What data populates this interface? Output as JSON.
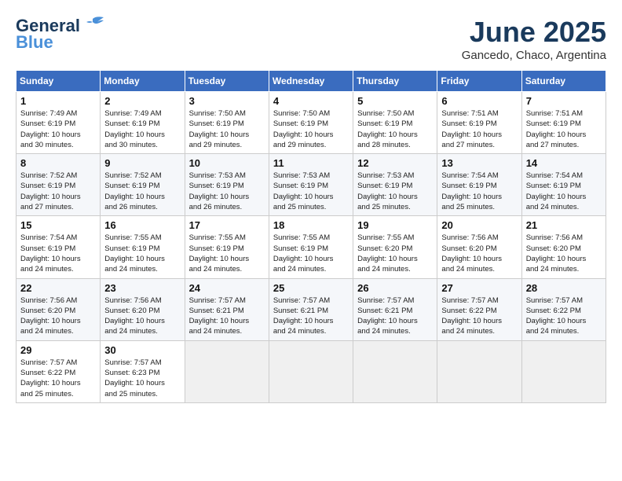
{
  "logo": {
    "line1": "General",
    "line2": "Blue"
  },
  "title": {
    "month": "June 2025",
    "location": "Gancedo, Chaco, Argentina"
  },
  "days_of_week": [
    "Sunday",
    "Monday",
    "Tuesday",
    "Wednesday",
    "Thursday",
    "Friday",
    "Saturday"
  ],
  "weeks": [
    [
      {
        "day": "1",
        "info": "Sunrise: 7:49 AM\nSunset: 6:19 PM\nDaylight: 10 hours\nand 30 minutes."
      },
      {
        "day": "2",
        "info": "Sunrise: 7:49 AM\nSunset: 6:19 PM\nDaylight: 10 hours\nand 30 minutes."
      },
      {
        "day": "3",
        "info": "Sunrise: 7:50 AM\nSunset: 6:19 PM\nDaylight: 10 hours\nand 29 minutes."
      },
      {
        "day": "4",
        "info": "Sunrise: 7:50 AM\nSunset: 6:19 PM\nDaylight: 10 hours\nand 29 minutes."
      },
      {
        "day": "5",
        "info": "Sunrise: 7:50 AM\nSunset: 6:19 PM\nDaylight: 10 hours\nand 28 minutes."
      },
      {
        "day": "6",
        "info": "Sunrise: 7:51 AM\nSunset: 6:19 PM\nDaylight: 10 hours\nand 27 minutes."
      },
      {
        "day": "7",
        "info": "Sunrise: 7:51 AM\nSunset: 6:19 PM\nDaylight: 10 hours\nand 27 minutes."
      }
    ],
    [
      {
        "day": "8",
        "info": "Sunrise: 7:52 AM\nSunset: 6:19 PM\nDaylight: 10 hours\nand 27 minutes."
      },
      {
        "day": "9",
        "info": "Sunrise: 7:52 AM\nSunset: 6:19 PM\nDaylight: 10 hours\nand 26 minutes."
      },
      {
        "day": "10",
        "info": "Sunrise: 7:53 AM\nSunset: 6:19 PM\nDaylight: 10 hours\nand 26 minutes."
      },
      {
        "day": "11",
        "info": "Sunrise: 7:53 AM\nSunset: 6:19 PM\nDaylight: 10 hours\nand 25 minutes."
      },
      {
        "day": "12",
        "info": "Sunrise: 7:53 AM\nSunset: 6:19 PM\nDaylight: 10 hours\nand 25 minutes."
      },
      {
        "day": "13",
        "info": "Sunrise: 7:54 AM\nSunset: 6:19 PM\nDaylight: 10 hours\nand 25 minutes."
      },
      {
        "day": "14",
        "info": "Sunrise: 7:54 AM\nSunset: 6:19 PM\nDaylight: 10 hours\nand 24 minutes."
      }
    ],
    [
      {
        "day": "15",
        "info": "Sunrise: 7:54 AM\nSunset: 6:19 PM\nDaylight: 10 hours\nand 24 minutes."
      },
      {
        "day": "16",
        "info": "Sunrise: 7:55 AM\nSunset: 6:19 PM\nDaylight: 10 hours\nand 24 minutes."
      },
      {
        "day": "17",
        "info": "Sunrise: 7:55 AM\nSunset: 6:19 PM\nDaylight: 10 hours\nand 24 minutes."
      },
      {
        "day": "18",
        "info": "Sunrise: 7:55 AM\nSunset: 6:19 PM\nDaylight: 10 hours\nand 24 minutes."
      },
      {
        "day": "19",
        "info": "Sunrise: 7:55 AM\nSunset: 6:20 PM\nDaylight: 10 hours\nand 24 minutes."
      },
      {
        "day": "20",
        "info": "Sunrise: 7:56 AM\nSunset: 6:20 PM\nDaylight: 10 hours\nand 24 minutes."
      },
      {
        "day": "21",
        "info": "Sunrise: 7:56 AM\nSunset: 6:20 PM\nDaylight: 10 hours\nand 24 minutes."
      }
    ],
    [
      {
        "day": "22",
        "info": "Sunrise: 7:56 AM\nSunset: 6:20 PM\nDaylight: 10 hours\nand 24 minutes."
      },
      {
        "day": "23",
        "info": "Sunrise: 7:56 AM\nSunset: 6:20 PM\nDaylight: 10 hours\nand 24 minutes."
      },
      {
        "day": "24",
        "info": "Sunrise: 7:57 AM\nSunset: 6:21 PM\nDaylight: 10 hours\nand 24 minutes."
      },
      {
        "day": "25",
        "info": "Sunrise: 7:57 AM\nSunset: 6:21 PM\nDaylight: 10 hours\nand 24 minutes."
      },
      {
        "day": "26",
        "info": "Sunrise: 7:57 AM\nSunset: 6:21 PM\nDaylight: 10 hours\nand 24 minutes."
      },
      {
        "day": "27",
        "info": "Sunrise: 7:57 AM\nSunset: 6:22 PM\nDaylight: 10 hours\nand 24 minutes."
      },
      {
        "day": "28",
        "info": "Sunrise: 7:57 AM\nSunset: 6:22 PM\nDaylight: 10 hours\nand 24 minutes."
      }
    ],
    [
      {
        "day": "29",
        "info": "Sunrise: 7:57 AM\nSunset: 6:22 PM\nDaylight: 10 hours\nand 25 minutes."
      },
      {
        "day": "30",
        "info": "Sunrise: 7:57 AM\nSunset: 6:23 PM\nDaylight: 10 hours\nand 25 minutes."
      },
      {
        "day": "",
        "info": ""
      },
      {
        "day": "",
        "info": ""
      },
      {
        "day": "",
        "info": ""
      },
      {
        "day": "",
        "info": ""
      },
      {
        "day": "",
        "info": ""
      }
    ]
  ]
}
